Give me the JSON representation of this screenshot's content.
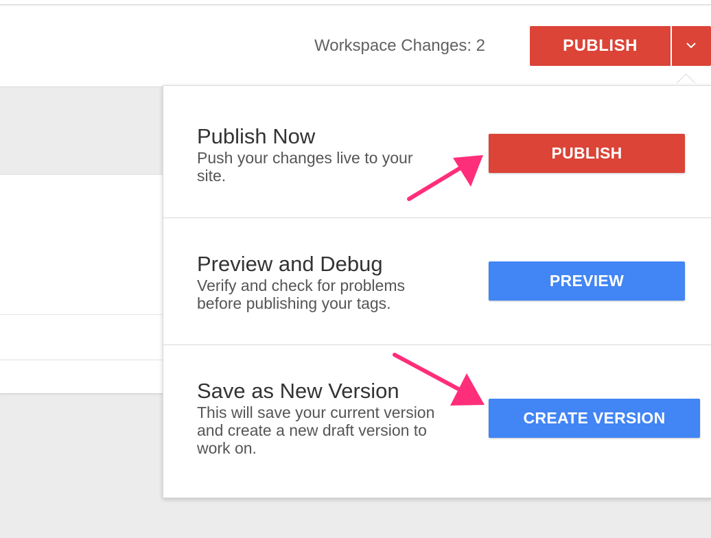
{
  "header": {
    "workspace_changes": "Workspace Changes: 2",
    "publish_label": "PUBLISH",
    "toggle_icon": "chevron-down-icon"
  },
  "dropdown": {
    "sections": [
      {
        "title": "Publish Now",
        "description": "Push your changes live to your site.",
        "button_label": "PUBLISH",
        "button_color": "#db4437"
      },
      {
        "title": "Preview and Debug",
        "description": "Verify and check for problems before publishing your tags.",
        "button_label": "PREVIEW",
        "button_color": "#4285f4"
      },
      {
        "title": "Save as New Version",
        "description": "This will save your current version and create a new draft version to work on.",
        "button_label": "CREATE VERSION",
        "button_color": "#4285f4"
      }
    ]
  },
  "annotations": {
    "arrow_color": "#ff2e7a"
  },
  "colors": {
    "publish_red": "#db4437",
    "action_blue": "#4285f4",
    "background": "#ececec"
  }
}
